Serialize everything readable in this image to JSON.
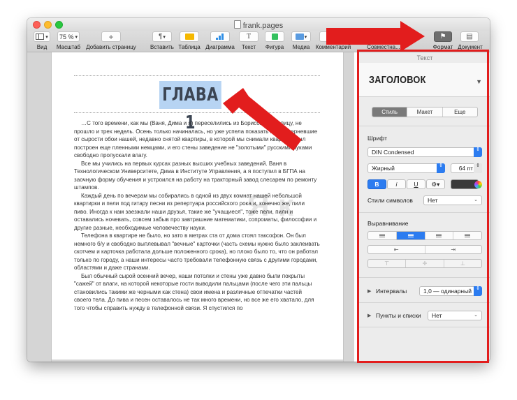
{
  "window": {
    "filename": "frank.pages"
  },
  "toolbar": {
    "view_label": "Вид",
    "zoom_value": "75 %",
    "zoom_label": "Масштаб",
    "add_page_label": "Добавить страницу",
    "insert_label": "Вставить",
    "table_label": "Таблица",
    "chart_label": "Диаграмма",
    "text_label": "Текст",
    "shape_label": "Фигура",
    "media_label": "Медиа",
    "comment_label": "Комментарий",
    "collab_label": "Совместна...",
    "format_label": "Формат",
    "document_label": "Документ",
    "add_glyph": "+",
    "text_glyph": "T",
    "insert_glyph": "¶",
    "insert_chev": "▾",
    "zoom_chev": "▾",
    "comment_glyph": "▭",
    "format_glyph": "⚑",
    "document_glyph": "▤"
  },
  "document": {
    "heading": "ГЛАВА 1",
    "paragraphs": [
      "…С того времени, как мы (Ваня, Дима и я) переселились из Борисова в столицу, не прошло и трех недель. Осень только начиналась, но уже успела показать нам почерневшие от сырости обои нашей, недавно снятой квартиры, в которой мы снимали квартиру был построен еще пленными немцами, и его стены заведение не \"золотыми\" русскими руками свободно пропускали влагу.",
      "Все мы учились на первых курсах разных высших учебных заведений. Ваня в Технологическом Университете, Дима в Институте Управления, а я поступил в БГПА на заочную форму обучения и устроился на работу на тракторный завод слесарем по ремонту штампов.",
      "Каждый день по вечерам мы собирались в одной из двух комнат нашей небольшой квартирки и пели под гитару песни из репертуара российского рока и, конечно же, пили пиво. Иногда к нам заезжали наши друзья, такие же \"учащиеся\", тоже пели, пили и оставались ночевать, совсем забыв про завтрашние математики, сопроматы, философии и другие разные, необходимые человечеству науки.",
      "Телефона в квартире не было, но зато в метрах ста от дома стоял таксофон. Он был немного б/у и свободно выплевывал \"вечные\" карточки (часть схемы нужно было заклеивать скотчем и карточка работала дольше положенного срока), но плохо было то, что он работал только по городу, а наши интересы часто требовали телефонную связь с другими городами, областями и даже странами.",
      "Был обычный сырой осенний вечер, наши потолки и стены уже давно были покрыты \"сажей\" от влаги, на которой некоторые гости выводили пальцами (после чего эти пальцы становились такими же черными как стена) свои имена и различные отпечатки частей своего тела. До пива и песен оставалось не так много времени, но все же его хватало, для того чтобы справить нужду в телефонной связи. Я спустился по"
    ],
    "watermark": "Я    к"
  },
  "inspector": {
    "title": "Текст",
    "style_name": "ЗАГОЛОВОК",
    "style_chev": "▼",
    "tabs": [
      "Стиль",
      "Макет",
      "Еще"
    ],
    "font_section": "Шрифт",
    "font_family": "DIN Condensed",
    "font_weight": "Жирный",
    "font_size": "64 пт",
    "bold": "B",
    "italic": "i",
    "underline": "U",
    "gear": "⚙▾",
    "char_styles_label": "Стили символов",
    "char_styles_value": "Нет",
    "alignment_section": "Выравнивание",
    "spacing_label": "Интервалы",
    "spacing_value": "1,0 — одинарный",
    "bullets_label": "Пункты и списки",
    "bullets_value": "Нет",
    "disclosure": "▶",
    "step_glyph": "⇕",
    "select_chev": "⌄",
    "indent_left": "⇤",
    "indent_right": "⇥",
    "valign_top": "⊤",
    "valign_middle": "✛",
    "valign_bottom": "⊥"
  }
}
